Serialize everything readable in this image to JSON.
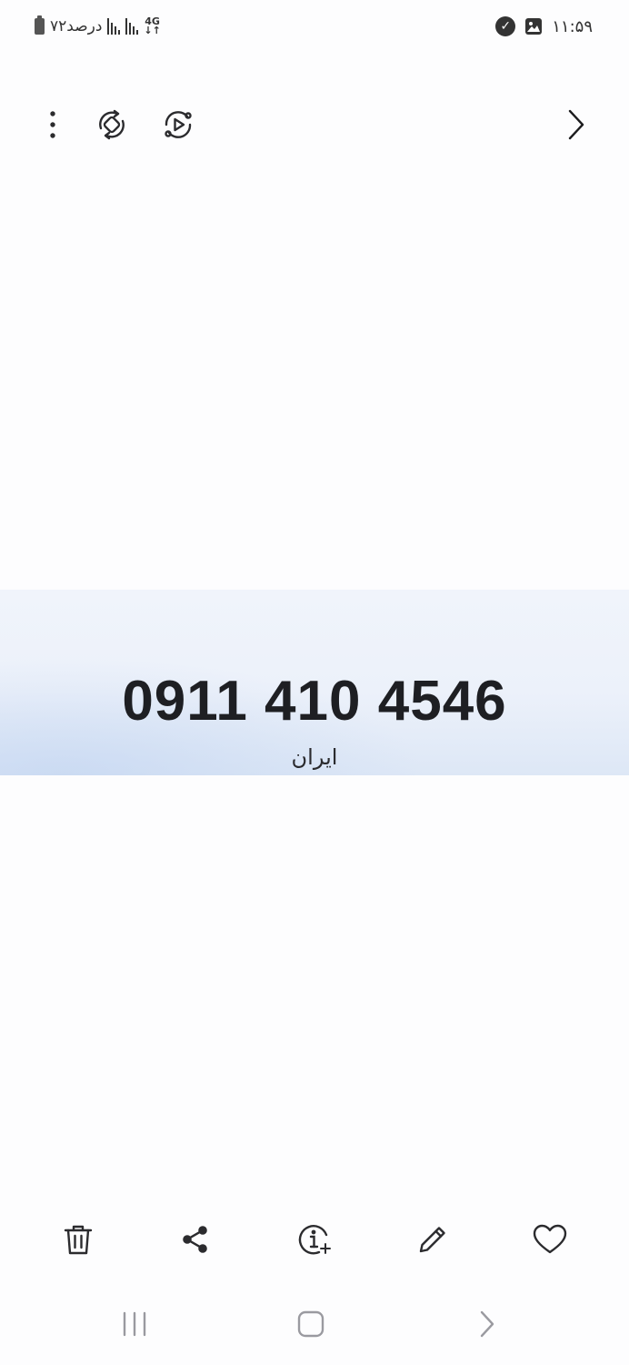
{
  "status_bar": {
    "battery_text": "۷۲درصد",
    "network_type": "4G",
    "time": "۱۱:۵۹"
  },
  "toolbar": {
    "icons": [
      "more-options-icon",
      "auto-rotate-icon",
      "motion-play-icon",
      "next-chevron-icon"
    ]
  },
  "photo": {
    "phone_number": "0911 410 4546",
    "country": "ایران"
  },
  "bottom_actions": {
    "icons": [
      "trash-icon",
      "share-icon",
      "info-icon",
      "edit-icon",
      "favorite-icon"
    ]
  },
  "nav_bar": {
    "icons": [
      "recent-apps-icon",
      "home-icon",
      "back-icon"
    ]
  },
  "colors": {
    "background": "#fdfdfe",
    "icon": "#2b2b2e",
    "nav_icon": "#9a9aa0"
  }
}
